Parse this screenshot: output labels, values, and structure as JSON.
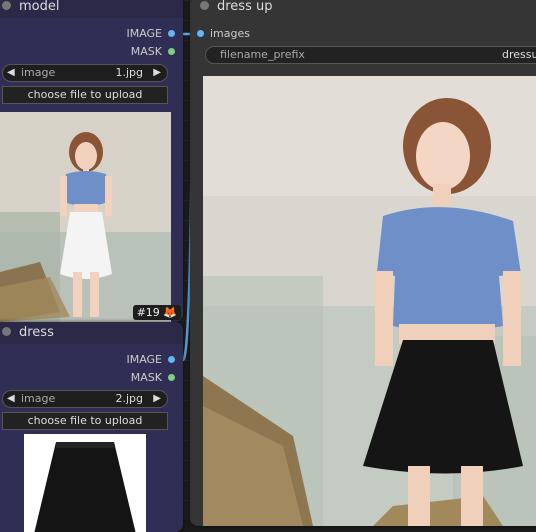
{
  "model_node": {
    "title": "model",
    "outputs": [
      {
        "label": "IMAGE"
      },
      {
        "label": "MASK"
      }
    ],
    "image_widget": {
      "label": "image",
      "value": "1.jpg"
    },
    "upload_button": "choose file to upload",
    "badge": "#19 🦊"
  },
  "dress_node": {
    "title": "dress",
    "outputs": [
      {
        "label": "IMAGE"
      },
      {
        "label": "MASK"
      }
    ],
    "image_widget": {
      "label": "image",
      "value": "2.jpg"
    },
    "upload_button": "choose file to upload"
  },
  "save_node": {
    "title": "dress up",
    "input": {
      "label": "images"
    },
    "filename_prefix": {
      "label": "filename_prefix",
      "value": "dressup"
    }
  },
  "colors": {
    "node_bg": "#312e55",
    "image_pin": "#64b5f6",
    "mask_pin": "#7ecf7e",
    "link": "#64b5f6"
  }
}
